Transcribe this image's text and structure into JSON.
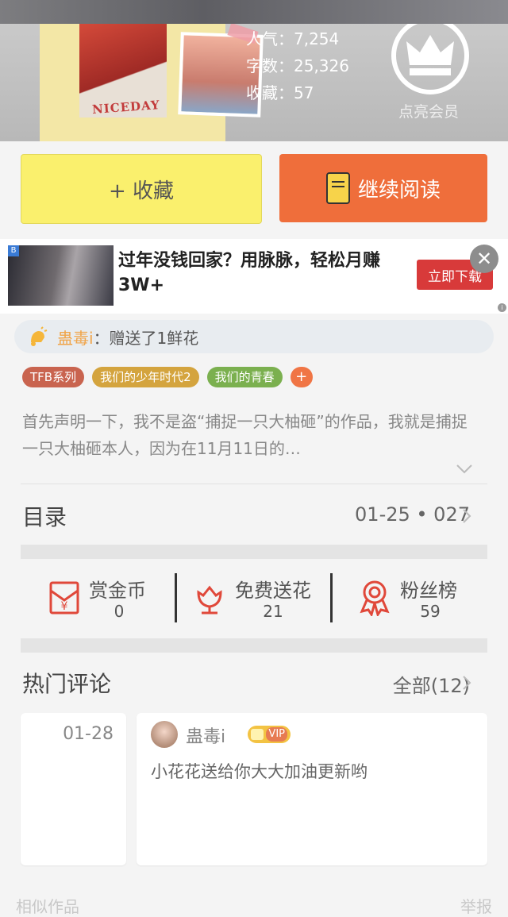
{
  "header": {
    "stats": {
      "popularity": "人气：7,254",
      "word_count": "字数：25,326",
      "favorites": "收藏：57"
    },
    "cover_label": "NICEDAY",
    "member_label": "点亮会员",
    "crown_icon": "crown-icon"
  },
  "actions": {
    "favorite_label": "+ 收藏",
    "read_label": "继续阅读",
    "read_color": "#ef6e3b",
    "favorite_color": "#faf06d"
  },
  "ad": {
    "text": "过年没钱回家？用脉脉，轻松月赚3W+",
    "cta": "立即下载",
    "close": "✕"
  },
  "flower_notice": {
    "user": "蛊毒i",
    "message": "：赠送了1鲜花"
  },
  "tags": [
    {
      "label": "TFB系列",
      "color": "#c9644f"
    },
    {
      "label": "我们的少年时代2",
      "color": "#d4a43e"
    },
    {
      "label": "我们的青春",
      "color": "#7bb04f"
    }
  ],
  "tag_add": "+",
  "description": "首先声明一下，我不是盗“捕捉一只大柚砸”的作品，我就是捕捉一只大柚砸本人，因为在11月11日的…",
  "catalog": {
    "title": "目录",
    "latest": "01-25 • 027"
  },
  "counters": [
    {
      "label": "赏金币",
      "value": "0",
      "icon": "red-envelope-icon"
    },
    {
      "label": "免费送花",
      "value": "21",
      "icon": "flower-icon"
    },
    {
      "label": "粉丝榜",
      "value": "59",
      "icon": "medal-icon"
    }
  ],
  "comments": {
    "title": "热门评论",
    "all_label": "全部(12)",
    "prev_date": "01-28",
    "items": [
      {
        "user": "蛊毒i",
        "badge": "VIP",
        "text": "小花花送给你大大加油更新哟"
      }
    ]
  },
  "footer_peek": {
    "left": "相似作品",
    "right": "举报"
  },
  "colors": {
    "accent_orange": "#ef6e3b",
    "icon_red": "#e0483a"
  }
}
